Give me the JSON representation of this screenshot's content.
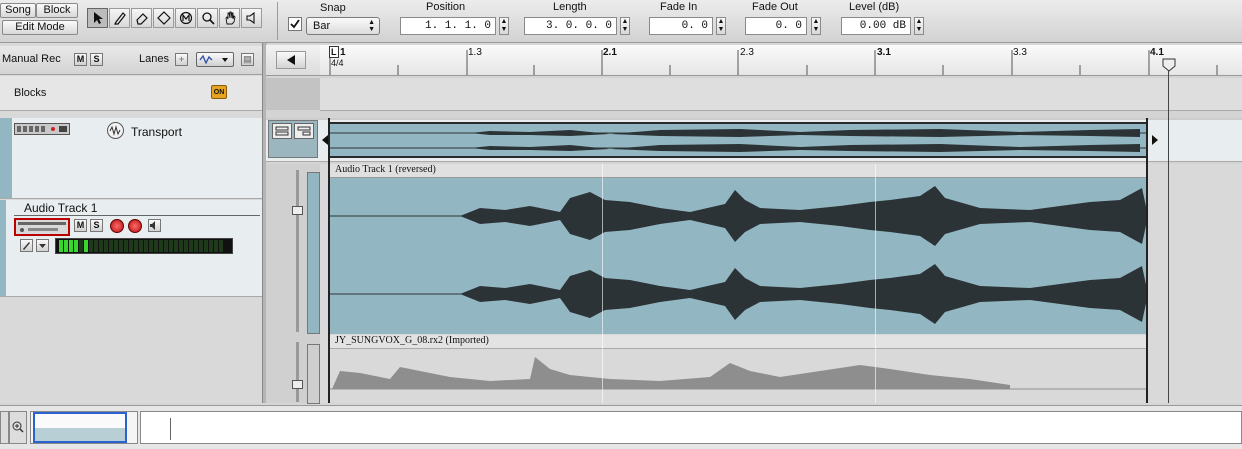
{
  "toolbar": {
    "song_label": "Song",
    "block_label": "Block",
    "edit_mode_label": "Edit Mode",
    "snap_label": "Snap",
    "snap_value": "Bar",
    "position_label": "Position",
    "position_value": "1.  1.  1.   0",
    "length_label": "Length",
    "length_value": "3.  0.  0.   0",
    "fade_in_label": "Fade In",
    "fade_in_value": "0.   0",
    "fade_out_label": "Fade Out",
    "fade_out_value": "0.   0",
    "level_label": "Level (dB)",
    "level_value": "0.00 dB"
  },
  "track_header": {
    "manual_rec": "Manual Rec",
    "m": "M",
    "s": "S",
    "lanes": "Lanes",
    "blocks": "Blocks",
    "on_badge": "ON",
    "transport": "Transport",
    "audio_track_name": "Audio Track 1"
  },
  "ruler": {
    "marks": [
      "1",
      "1.3",
      "2.1",
      "2.3",
      "3.1",
      "3.3",
      "4.1"
    ],
    "timesig": "4/4",
    "left_locator": "L"
  },
  "clips": {
    "audio_clip": "Audio Track 1 (reversed)",
    "rx2_clip": "JY_SUNGVOX_G_08.rx2 (Imported)"
  },
  "colors": {
    "clip_blue": "#93b7c2",
    "waveform": "#2c3336",
    "rx2_wave": "#8e8e8e",
    "meter_green": "#39d62f"
  }
}
